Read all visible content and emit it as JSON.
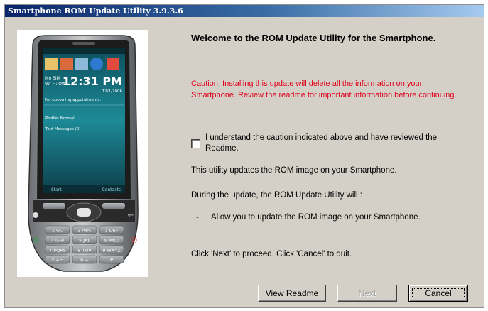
{
  "window": {
    "title": "Smartphone ROM Update Utility 3.9.3.6"
  },
  "phone": {
    "status_sim": "No SIM",
    "status_wifi": "Wi-Fi: Off",
    "time": "12:31 PM",
    "date": "12/1/2006",
    "appointments": "No upcoming appointments.",
    "profile": "Profile: Normal",
    "messages": "Text Messages (0)",
    "softkey_left": "Start",
    "softkey_right": "Contacts",
    "keys": [
      [
        "1 GO",
        "2 ABC",
        "3 DEF"
      ],
      [
        "4 GHI",
        "5 JKL",
        "6 MNO"
      ],
      [
        "7 PQRS",
        "8 TUV",
        "9 WXYZ"
      ],
      [
        "* +=",
        "0 +",
        "#"
      ]
    ]
  },
  "main": {
    "welcome": "Welcome to the ROM Update Utility for the Smartphone.",
    "caution": "Caution: Installing this update will delete all the information on your Smartphone. Review the readme for important information before continuing.",
    "checkbox_label": "I understand the caution indicated above and have reviewed the Readme.",
    "checkbox_checked": false,
    "line1": "This utility updates the ROM image on your Smartphone.",
    "line2": "During the update, the ROM Update Utility will :",
    "bullet_dash": "-",
    "bullet1": "Allow you to update the ROM image on your Smartphone.",
    "line3": "Click 'Next' to proceed. Click 'Cancel' to quit."
  },
  "buttons": {
    "view_readme": "View Readme",
    "next": "Next",
    "cancel": "Cancel"
  },
  "colors": {
    "caution": "#e0001a",
    "title_start": "#0a246a",
    "title_end": "#a6caf0"
  }
}
